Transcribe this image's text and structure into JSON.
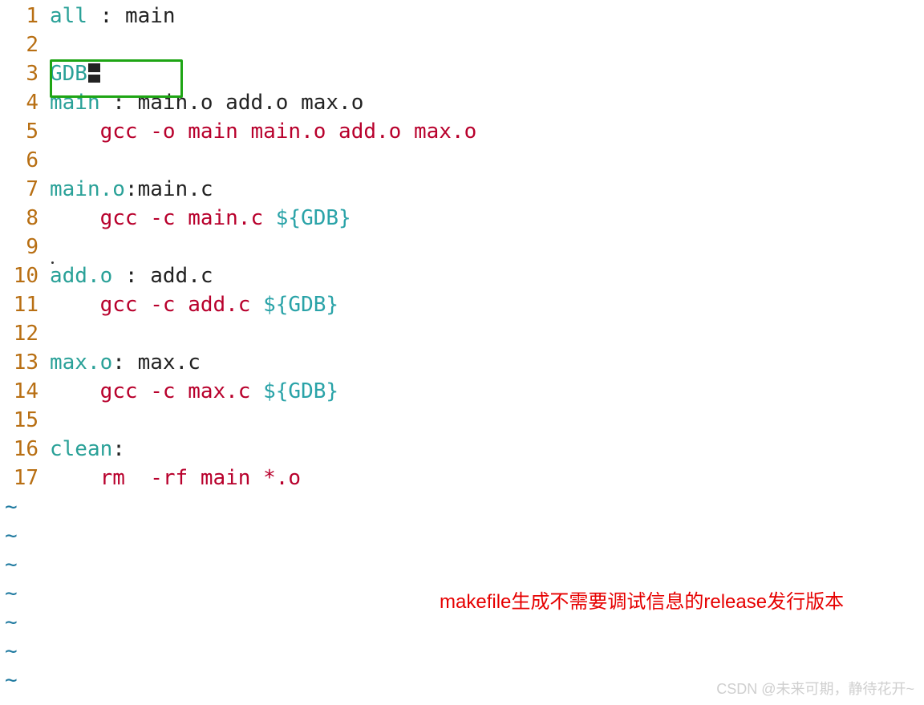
{
  "editor": {
    "lines": [
      {
        "num": "1"
      },
      {
        "num": "2"
      },
      {
        "num": "3"
      },
      {
        "num": "4"
      },
      {
        "num": "5"
      },
      {
        "num": "6"
      },
      {
        "num": "7"
      },
      {
        "num": "8"
      },
      {
        "num": "9"
      },
      {
        "num": "10"
      },
      {
        "num": "11"
      },
      {
        "num": "12"
      },
      {
        "num": "13"
      },
      {
        "num": "14"
      },
      {
        "num": "15"
      },
      {
        "num": "16"
      },
      {
        "num": "17"
      }
    ],
    "tilde": "~",
    "l1": {
      "target": "all",
      "sep": " : ",
      "deps": "main"
    },
    "l3": {
      "var": "GDB"
    },
    "l4": {
      "target": "main",
      "sep": " : ",
      "deps": "main.o add.o max.o"
    },
    "l5": {
      "indent": "    ",
      "cmd": "gcc -o main main.o add.o max.o"
    },
    "l7": {
      "target": "main.o",
      "sep": ":",
      "deps": "main.c"
    },
    "l8": {
      "indent": "    ",
      "cmd": "gcc -c main.c ",
      "var": "${GDB}"
    },
    "l10": {
      "target": "add.o",
      "sep": " : ",
      "deps": "add.c"
    },
    "l11": {
      "indent": "    ",
      "cmd": "gcc -c add.c ",
      "var": "${GDB}"
    },
    "l13": {
      "target": "max.o",
      "sep": ": ",
      "deps": "max.c"
    },
    "l14": {
      "indent": "    ",
      "cmd": "gcc -c max.c ",
      "var": "${GDB}"
    },
    "l16": {
      "target": "clean",
      "sep": ":"
    },
    "l17": {
      "indent": "    ",
      "cmd": "rm  -rf main *.o"
    }
  },
  "annotation": "makefile生成不需要调试信息的release发行版本",
  "watermark": "CSDN @未来可期，静待花开~"
}
